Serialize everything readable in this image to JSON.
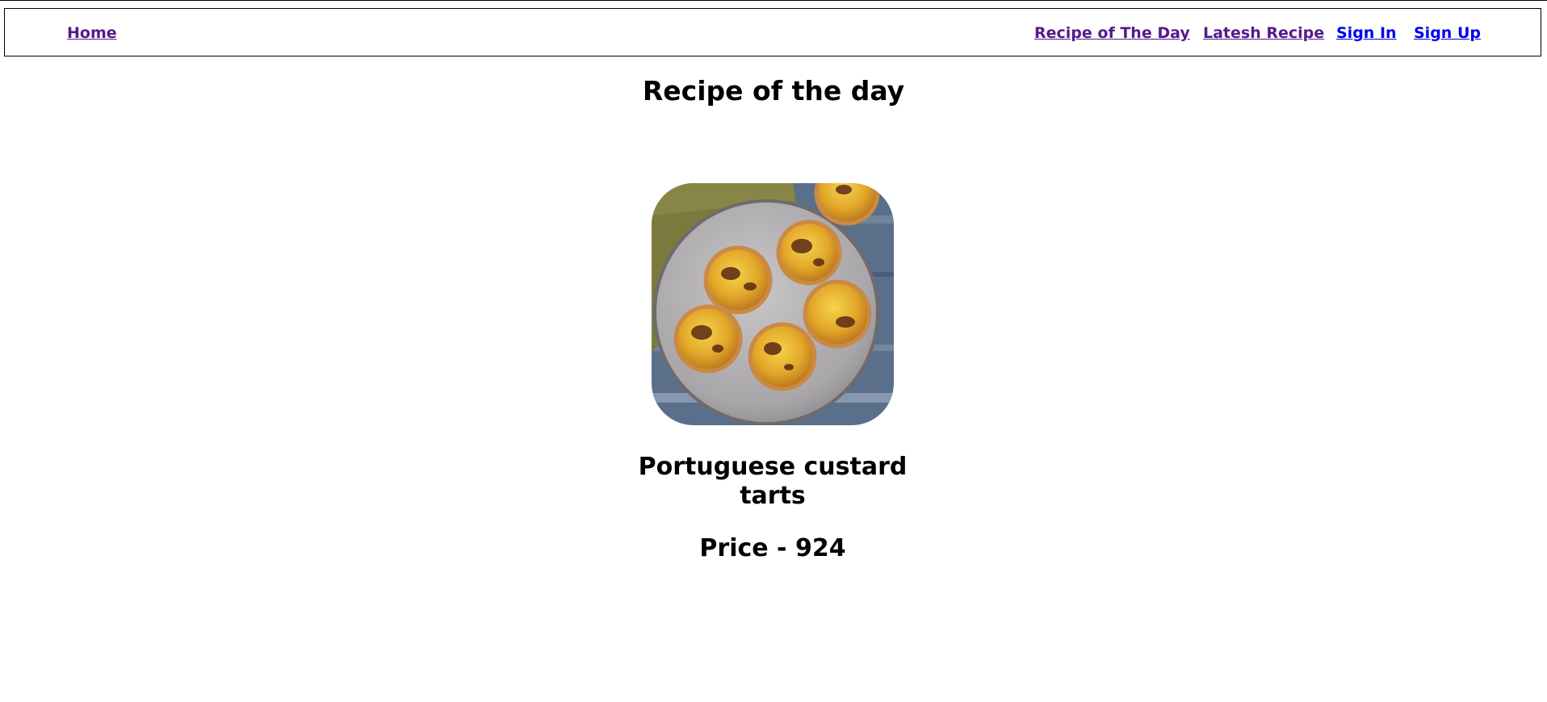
{
  "nav": {
    "home": "Home",
    "recipe_of_the_day": "Recipe of The Day",
    "latest_recipe": "Latesh Recipe",
    "sign_in": "Sign In",
    "sign_up": "Sign Up"
  },
  "page": {
    "heading": "Recipe of the day"
  },
  "recipe": {
    "name": "Portuguese custard tarts",
    "price": "Price - 924",
    "image_subject": "custard-tarts-on-plate"
  },
  "colors": {
    "visited_link": "#551a8b",
    "unvisited_link": "#0000ee"
  }
}
